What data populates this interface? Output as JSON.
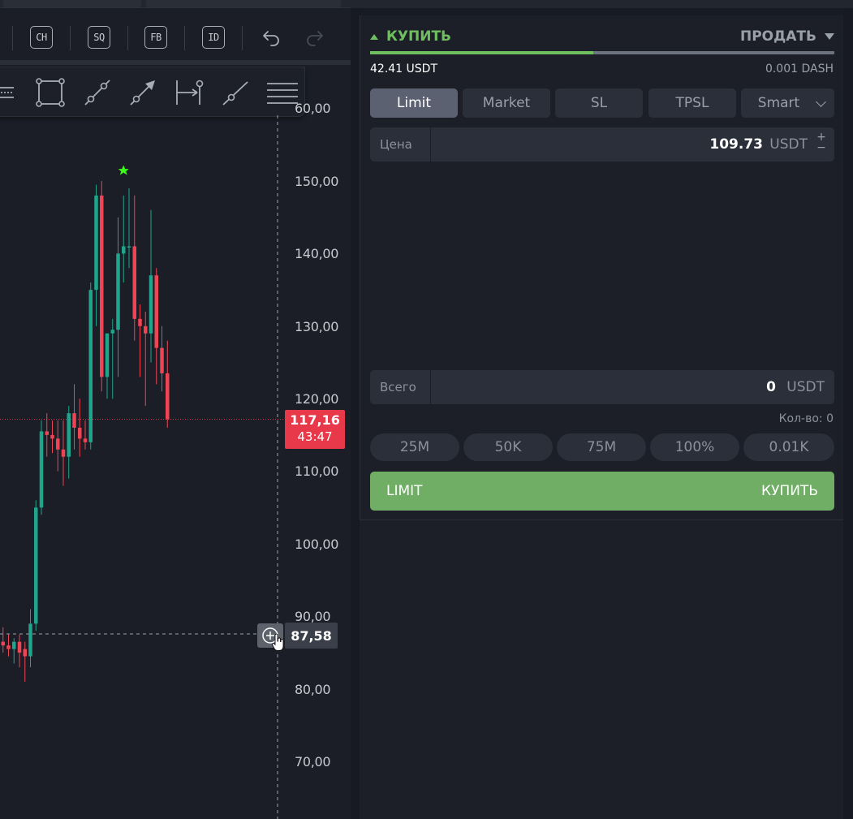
{
  "toolbar": {
    "buttons": [
      "CH",
      "SQ",
      "FB",
      "ID"
    ],
    "undo_icon": "undo-icon",
    "redo_icon": "redo-icon"
  },
  "drawing_tools": [
    "fib-extension-icon",
    "rectangle-icon",
    "trend-line-icon",
    "arrow-line-icon",
    "range-icon",
    "ray-icon",
    "more-tools-icon"
  ],
  "chart_data": {
    "type": "candlestick",
    "y_axis_labels": [
      "60,00",
      "150,00",
      "140,00",
      "130,00",
      "120,00",
      "110,00",
      "100,00",
      "90,00",
      "80,00",
      "70,00"
    ],
    "ylim": [
      65,
      162
    ],
    "last_price": "117,16",
    "countdown": "43:47",
    "crosshair_price": "87,58",
    "candles": [
      {
        "o": 86.5,
        "h": 88.5,
        "l": 85,
        "c": 86
      },
      {
        "o": 86,
        "h": 87.5,
        "l": 84.5,
        "c": 85.5
      },
      {
        "o": 85.5,
        "h": 87,
        "l": 83.5,
        "c": 86.5
      },
      {
        "o": 86.5,
        "h": 87.5,
        "l": 83,
        "c": 85
      },
      {
        "o": 85.5,
        "h": 86.5,
        "l": 81,
        "c": 84.5
      },
      {
        "o": 84.5,
        "h": 91,
        "l": 83,
        "c": 89
      },
      {
        "o": 89,
        "h": 106,
        "l": 88,
        "c": 105
      },
      {
        "o": 105,
        "h": 117,
        "l": 104,
        "c": 115.5
      },
      {
        "o": 115.5,
        "h": 118,
        "l": 112,
        "c": 115
      },
      {
        "o": 115,
        "h": 117,
        "l": 112.5,
        "c": 114.5
      },
      {
        "o": 114.5,
        "h": 117,
        "l": 110,
        "c": 113
      },
      {
        "o": 113,
        "h": 117,
        "l": 108,
        "c": 112
      },
      {
        "o": 112,
        "h": 119,
        "l": 109,
        "c": 118
      },
      {
        "o": 118,
        "h": 122,
        "l": 113,
        "c": 116
      },
      {
        "o": 116,
        "h": 120,
        "l": 112,
        "c": 114.5
      },
      {
        "o": 114.5,
        "h": 117,
        "l": 113,
        "c": 114
      },
      {
        "o": 114,
        "h": 136,
        "l": 113,
        "c": 135
      },
      {
        "o": 135,
        "h": 149.5,
        "l": 130,
        "c": 148
      },
      {
        "o": 148,
        "h": 150,
        "l": 121,
        "c": 123
      },
      {
        "o": 123,
        "h": 129,
        "l": 120,
        "c": 129
      },
      {
        "o": 129,
        "h": 131,
        "l": 120,
        "c": 129.5
      },
      {
        "o": 129.5,
        "h": 145,
        "l": 123,
        "c": 140
      },
      {
        "o": 140,
        "h": 148,
        "l": 136,
        "c": 141
      },
      {
        "o": 141,
        "h": 149,
        "l": 138,
        "c": 141
      },
      {
        "o": 141,
        "h": 148,
        "l": 128,
        "c": 131
      },
      {
        "o": 131,
        "h": 133,
        "l": 123,
        "c": 130
      },
      {
        "o": 130,
        "h": 132,
        "l": 119,
        "c": 129
      },
      {
        "o": 129,
        "h": 146,
        "l": 125,
        "c": 137
      },
      {
        "o": 137,
        "h": 138,
        "l": 122,
        "c": 127
      },
      {
        "o": 127,
        "h": 130,
        "l": 121,
        "c": 123.5
      },
      {
        "o": 123.5,
        "h": 128,
        "l": 116,
        "c": 117.16
      }
    ]
  },
  "order": {
    "buy_label": "КУПИТЬ",
    "sell_label": "ПРОДАТЬ",
    "side_ratio": 0.48,
    "balance_quote": "42.41 USDT",
    "balance_base": "0.001 DASH",
    "types": [
      "Limit",
      "Market",
      "SL",
      "TPSL",
      "Smart"
    ],
    "active_type": "Limit",
    "price_label": "Цена",
    "price_value": "109.73",
    "price_unit": "USDT",
    "total_label": "Всего",
    "total_value": "0",
    "total_unit": "USDT",
    "qty_note": "Кол-во: 0",
    "presets": [
      "25M",
      "50K",
      "75M",
      "100%",
      "0.01K"
    ],
    "submit_left": "LIMIT",
    "submit_right": "КУПИТЬ",
    "colors": {
      "buy": "#6fbf5f",
      "submit": "#6fae64",
      "sell_tag": "#e7394a",
      "bull": "#1fa58c",
      "bear": "#ef4453"
    }
  }
}
